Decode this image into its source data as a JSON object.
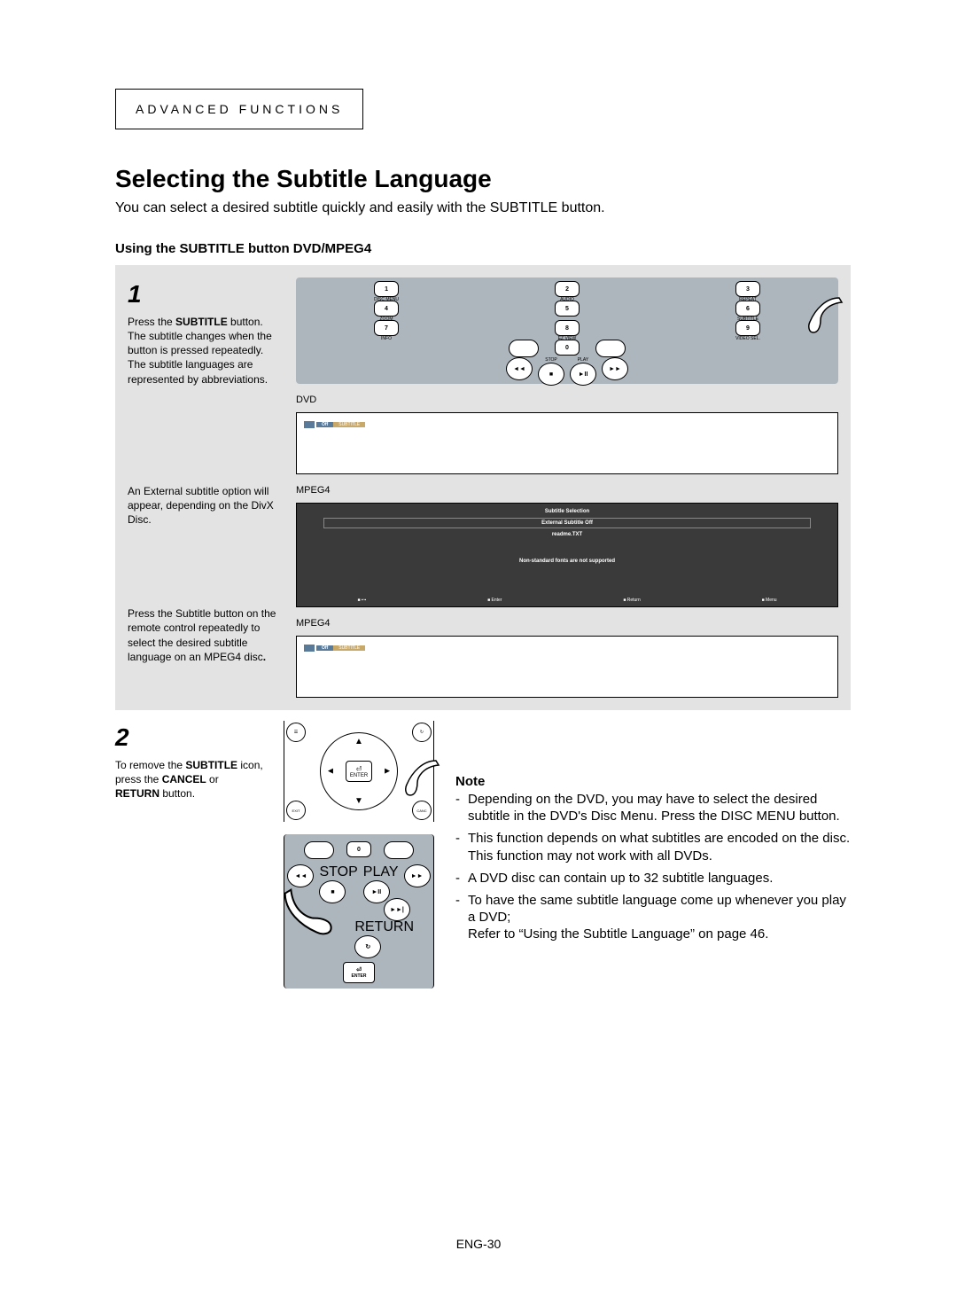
{
  "section_label": "ADVANCED FUNCTIONS",
  "title": "Selecting the Subtitle Language",
  "intro": "You can select a desired subtitle quickly and easily with the SUBTITLE button.",
  "sub_heading": "Using the SUBTITLE button DVD/MPEG4",
  "step1": {
    "num": "1",
    "p1a": "Press the ",
    "p1b": "SUBTITLE",
    "p1c": " button.",
    "p2": "The subtitle changes when the button is pressed repeatedly.",
    "p3": "The subtitle languages are represented by abbreviations.",
    "dvd_label": "DVD",
    "dvd_off": "Off",
    "dvd_tag": "SUBTITLE",
    "mpeg4_label": "MPEG4",
    "ext_para": "An External subtitle option will appear, depending on the DivX Disc.",
    "menu_title": "Subtitle Selection",
    "menu_opt1": "External Subtitle Off",
    "menu_opt2": "readme.TXT",
    "menu_note": "Non-standard fonts are not supported",
    "menu_enter": "Enter",
    "menu_return": "Return",
    "menu_menu": "Menu",
    "mpeg4b_label": "MPEG4",
    "mpeg4b_para": "Press the Subtitle button on the remote control repeatedly to select the desired subtitle language on an MPEG4 disc",
    "mpeg4b_off": "Off",
    "mpeg4b_tag": "SUBTITLE",
    "remote": {
      "r1": [
        "1",
        "2",
        "3"
      ],
      "r1l": [
        "DISC MENU",
        "AUDIO",
        "REPEAT"
      ],
      "r2": [
        "4",
        "5",
        "6"
      ],
      "r2l": [
        "ZOOM",
        "",
        "SUBTITLE"
      ],
      "r3": [
        "7",
        "8",
        "9"
      ],
      "r3l": [
        "INFO",
        "EZ VIEW",
        "VIDEO SEL."
      ],
      "r4": "0",
      "stop": "STOP",
      "play": "PLAY"
    }
  },
  "step2": {
    "num": "2",
    "p1a": "To remove the ",
    "p1b": "SUBTITLE",
    "p1c": " icon, press the ",
    "p1d": "CANCEL",
    "p1e": " or ",
    "p1f": "RETURN",
    "p1g": " button.",
    "enter": "ENTER",
    "exit": "EXIT",
    "canc": "CANC",
    "return_lbl": "RETURN",
    "stop": "STOP",
    "play": "PLAY",
    "zero": "0"
  },
  "notes": {
    "heading": "Note",
    "items": [
      "Depending on the DVD, you may have to select the desired subtitle in the DVD's Disc Menu. Press the DISC MENU button.",
      "This function depends on what subtitles are encoded on the disc. This function may not work with all DVDs.",
      "A DVD disc can contain up to 32 subtitle languages.",
      "To have the same subtitle language come up whenever you play a DVD;\nRefer to “Using the Subtitle Language” on page 46."
    ]
  },
  "footer": "ENG-30"
}
